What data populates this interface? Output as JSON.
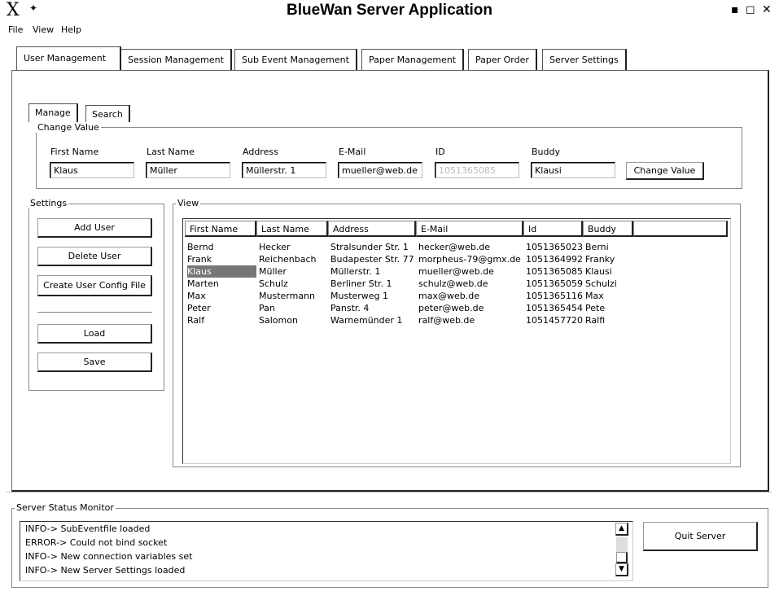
{
  "window": {
    "title": "BlueWan Server Application",
    "logo": "X",
    "pin": "✦",
    "controls": [
      "▪",
      "◻",
      "✕"
    ]
  },
  "menu": [
    "File",
    "View",
    "Help"
  ],
  "main_tabs": [
    {
      "label": "User Management",
      "active": true
    },
    {
      "label": "Session Management",
      "active": false
    },
    {
      "label": "Sub Event Management",
      "active": false
    },
    {
      "label": "Paper Management",
      "active": false
    },
    {
      "label": "Paper Order",
      "active": false
    },
    {
      "label": "Server Settings",
      "active": false
    }
  ],
  "sub_tabs": [
    {
      "label": "Manage",
      "active": true
    },
    {
      "label": "Search",
      "active": false
    }
  ],
  "change_value": {
    "group_label": "Change Value",
    "fields": [
      {
        "label": "First Name",
        "value": "Klaus",
        "disabled": false
      },
      {
        "label": "Last Name",
        "value": "Müller",
        "disabled": false
      },
      {
        "label": "Address",
        "value": "Müllerstr. 1",
        "disabled": false
      },
      {
        "label": "E-Mail",
        "value": "mueller@web.de",
        "disabled": false
      },
      {
        "label": "ID",
        "value": "1051365085",
        "disabled": true
      },
      {
        "label": "Buddy",
        "value": "Klausi",
        "disabled": false
      }
    ],
    "button": "Change Value"
  },
  "settings": {
    "group_label": "Settings",
    "buttons": [
      "Add User",
      "Delete User",
      "Create User Config File",
      "Load",
      "Save"
    ]
  },
  "view": {
    "group_label": "View",
    "columns": [
      "First Name",
      "Last Name",
      "Address",
      "E-Mail",
      "Id",
      "Buddy"
    ],
    "rows": [
      [
        "Bernd",
        "Hecker",
        "Stralsunder Str. 1",
        "hecker@web.de",
        "1051365023",
        "Berni"
      ],
      [
        "Frank",
        "Reichenbach",
        "Budapester Str. 77",
        "morpheus-79@gmx.de",
        "1051364992",
        "Franky"
      ],
      [
        "Klaus",
        "Müller",
        "Müllerstr. 1",
        "mueller@web.de",
        "1051365085",
        "Klausi"
      ],
      [
        "Marten",
        "Schulz",
        "Berliner Str. 1",
        "schulz@web.de",
        "1051365059",
        "Schulzi"
      ],
      [
        "Max",
        "Mustermann",
        "Musterweg 1",
        "max@web.de",
        "1051365116",
        "Max"
      ],
      [
        "Peter",
        "Pan",
        "Panstr. 4",
        "peter@web.de",
        "1051365454",
        "Pete"
      ],
      [
        "Ralf",
        "Salomon",
        "Warnemünder 1",
        "ralf@web.de",
        "1051457720",
        "Ralfi"
      ]
    ],
    "selected_row": 2
  },
  "status_monitor": {
    "group_label": "Server Status Monitor",
    "lines": [
      "INFO-> SubEventfile loaded",
      "ERROR-> Could not bind socket",
      "INFO-> New connection variables set",
      "INFO-> New Server Settings loaded"
    ],
    "quit_button": "Quit Server"
  }
}
